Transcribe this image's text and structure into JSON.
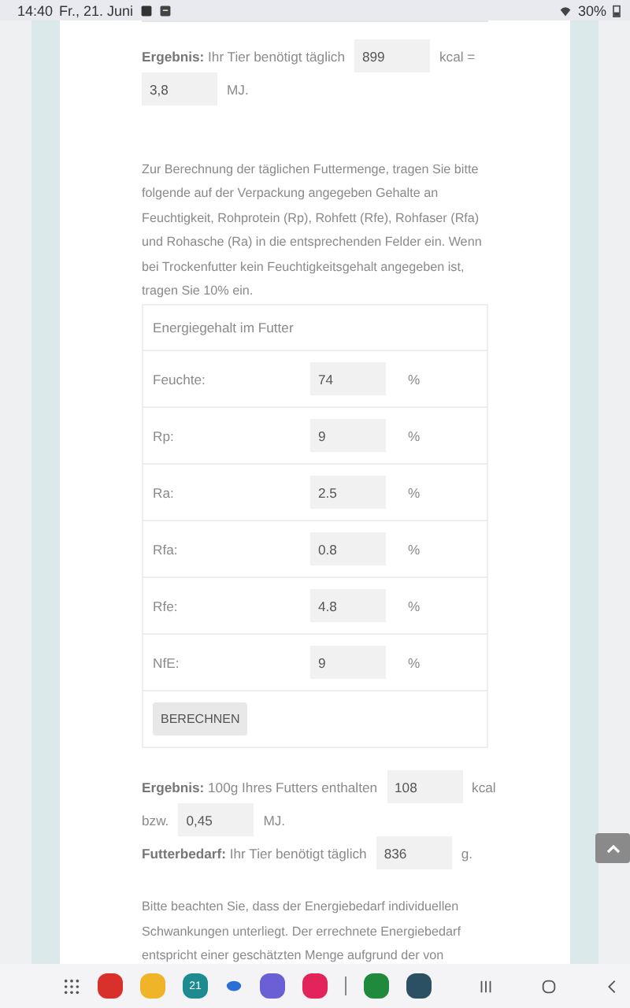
{
  "status_bar": {
    "time": "14:40",
    "date": "Fr., 21. Juni",
    "battery": "30%"
  },
  "result_energy": {
    "label": "Ergebnis:",
    "text": "Ihr Tier benötigt täglich",
    "kcal": "899",
    "kcal_unit": "kcal =",
    "mj": "3,8",
    "mj_unit": "MJ."
  },
  "instructions": "Zur Berechnung der täglichen Futtermenge, tragen Sie bitte folgende auf der Verpackung angegeben Gehalte an Feuchtigkeit, Rohprotein (Rp), Rohfett (Rfe), Rohfaser (Rfa) und Rohasche (Ra) in die entsprechenden Felder ein. Wenn bei Trockenfutter kein Feuchtigkeitsgehalt angegeben ist, tragen Sie 10% ein.",
  "table": {
    "title": "Energiegehalt im Futter",
    "rows": [
      {
        "label": "Feuchte:",
        "value": "74",
        "unit": "%"
      },
      {
        "label": "Rp:",
        "value": "9",
        "unit": "%"
      },
      {
        "label": "Ra:",
        "value": "2.5",
        "unit": "%"
      },
      {
        "label": "Rfa:",
        "value": "0.8",
        "unit": "%"
      },
      {
        "label": "Rfe:",
        "value": "4.8",
        "unit": "%"
      },
      {
        "label": "NfE:",
        "value": "9",
        "unit": "%"
      }
    ],
    "button": "BERECHNEN"
  },
  "result_food": {
    "label": "Ergebnis:",
    "text": "100g Ihres Futters enthalten",
    "kcal": "108",
    "kcal_unit": "kcal",
    "prefix": "bzw.",
    "mj": "0,45",
    "mj_unit": "MJ."
  },
  "requirement": {
    "label": "Futterbedarf:",
    "text": "Ihr Tier benötigt täglich",
    "value": "836",
    "unit": "g."
  },
  "note": "Bitte beachten Sie, dass der Energiebedarf individuellen Schwankungen unterliegt. Der errechnete Energiebedarf entspricht einer geschätzten Menge aufgrund der von",
  "taskbar": {
    "calendar_day": "21"
  }
}
